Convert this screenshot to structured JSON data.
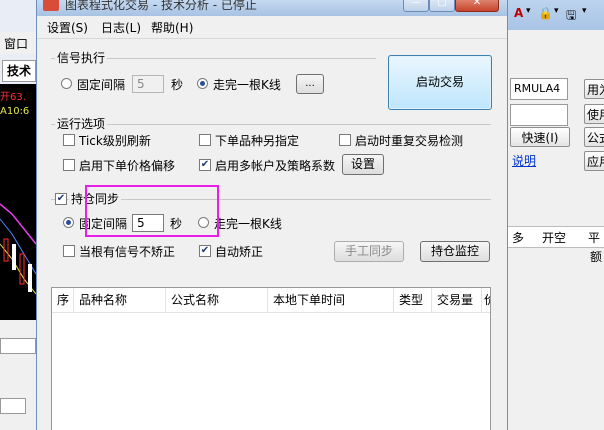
{
  "background_app": {
    "menu_window": "窗口",
    "tab_tech": "技术",
    "chart_text_1": "开63.",
    "chart_text_2": "A10:6",
    "right_formula": "RMULA4",
    "right_btn_1": "用为",
    "right_btn_2": "使用",
    "right_btn_3": "快速(I)",
    "right_btn_4": "公式",
    "right_link": "说明",
    "right_btn_5": "应用",
    "right_col_1": "多",
    "right_col_2": "开空",
    "right_col_3": "平",
    "right_cell": "额"
  },
  "dialog": {
    "title": "图表程式化交易 - 技术分析 - 已停止",
    "menu": {
      "settings": "设置(S)",
      "log": "日志(L)",
      "help": "帮助(H)"
    },
    "signal": {
      "group": "信号执行",
      "fixed_interval": "固定间隔",
      "interval_value": "5",
      "unit": "秒",
      "after_kline": "走完一根K线",
      "more": "...",
      "selected": "after_kline"
    },
    "start_button": "启动交易",
    "run_options": {
      "group": "运行选项",
      "tick_refresh": "Tick级别刷新",
      "order_other": "下单品种另指定",
      "restart_check": "启动时重复交易检测",
      "price_offset": "启用下单价格偏移",
      "multi_account": "启用多帐户及策略系数",
      "settings_btn": "设置",
      "checked": {
        "tick_refresh": false,
        "order_other": false,
        "restart_check": false,
        "price_offset": false,
        "multi_account": true
      }
    },
    "position_sync": {
      "group": "持仓同步",
      "enabled": true,
      "fixed_interval": "固定间隔",
      "interval_value": "5",
      "unit": "秒",
      "after_kline": "走完一根K线",
      "selected": "fixed_interval",
      "no_correct": "当根有信号不矫正",
      "auto_correct": "自动矫正",
      "no_correct_checked": false,
      "auto_correct_checked": true,
      "manual_sync": "手工同步",
      "monitor": "持仓监控"
    },
    "table": {
      "columns": [
        "序",
        "品种名称",
        "公式名称",
        "本地下单时间",
        "类型",
        "交易量",
        "价"
      ]
    }
  },
  "colors": {
    "highlight": "#e81fe8",
    "title_bar": "#a8c2e3",
    "button_blue": "#bee6fd"
  }
}
